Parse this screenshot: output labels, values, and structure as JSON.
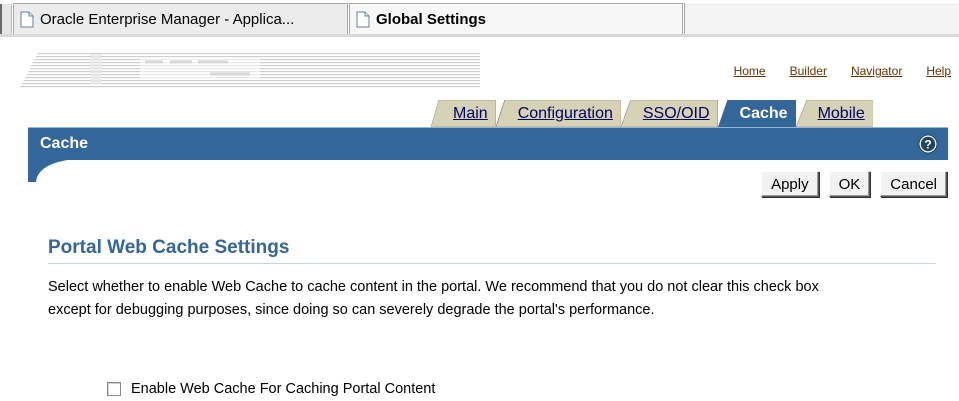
{
  "browser_tabs": [
    {
      "title": "Oracle Enterprise Manager - Applica...",
      "icon": "document-icon",
      "active": false
    },
    {
      "title": "Global Settings",
      "icon": "document-icon",
      "active": true
    }
  ],
  "header": {
    "global_links": [
      "Home",
      "Builder",
      "Navigator",
      "Help"
    ]
  },
  "tabs": [
    {
      "label": "Main",
      "active": false
    },
    {
      "label": "Configuration",
      "active": false
    },
    {
      "label": "SSO/OID",
      "active": false
    },
    {
      "label": "Cache",
      "active": true
    },
    {
      "label": "Mobile",
      "active": false
    }
  ],
  "page": {
    "title": "Cache",
    "help_icon": "help-icon"
  },
  "buttons": {
    "apply": "Apply",
    "ok": "OK",
    "cancel": "Cancel"
  },
  "section": {
    "title": "Portal Web Cache Settings",
    "description": "Select whether to enable Web Cache to cache content in the portal. We recommend that you do not clear this check box except for debugging purposes, since doing so can severely degrade the portal's performance.",
    "checkbox_label": "Enable Web Cache For Caching Portal Content",
    "checkbox_checked": false
  },
  "colors": {
    "brand_blue": "#336699",
    "tab_tan": "#d6d2b5",
    "link_brown": "#663300"
  }
}
